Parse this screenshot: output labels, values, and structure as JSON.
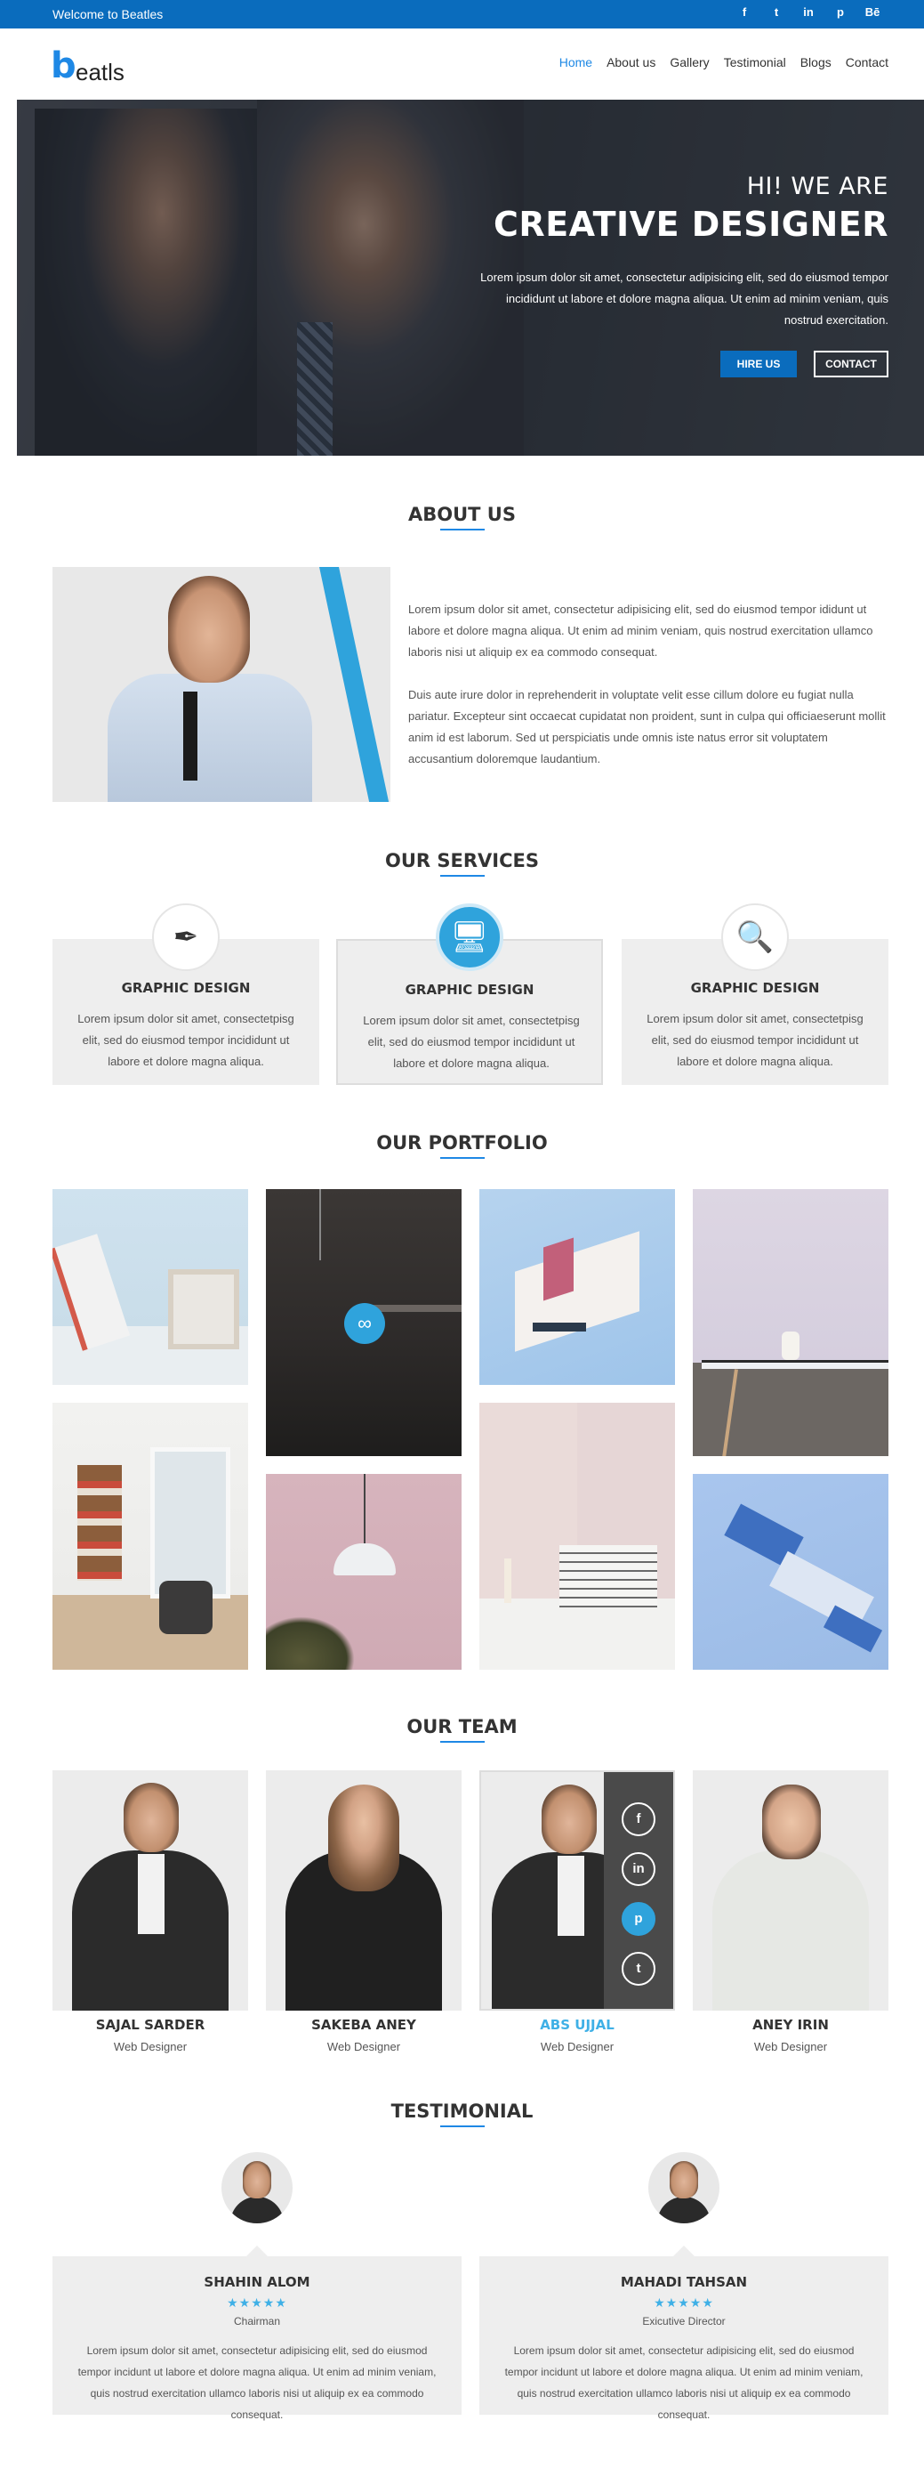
{
  "topbar": {
    "welcome": "Welcome to Beatles",
    "social": [
      {
        "icon": "facebook-icon",
        "glyph": "f"
      },
      {
        "icon": "twitter-icon",
        "glyph": "t"
      },
      {
        "icon": "linkedin-icon",
        "glyph": "in"
      },
      {
        "icon": "pinterest-icon",
        "glyph": "p"
      },
      {
        "icon": "behance-icon",
        "glyph": "Bē"
      }
    ]
  },
  "header": {
    "logo_b": "b",
    "logo_rest": "eatls",
    "nav": [
      "Home",
      "About us",
      "Gallery",
      "Testimonial",
      "Blogs",
      "Contact"
    ],
    "active": "Home"
  },
  "hero": {
    "line1": "HI! WE ARE",
    "line2": "CREATIVE DESIGNER",
    "desc": "Lorem ipsum dolor sit amet, consectetur adipisicing elit, sed do eiusmod tempor incididunt ut labore et dolore magna aliqua. Ut enim ad minim veniam, quis nostrud exercitation.",
    "hire": "HIRE US",
    "contact": "CONTACT"
  },
  "about": {
    "title": "ABOUT US",
    "p1": "Lorem ipsum dolor sit amet, consectetur adipisicing elit, sed do eiusmod tempor ididunt ut labore et dolore magna aliqua. Ut enim ad minim veniam, quis nostrud exercitation ullamco laboris nisi ut aliquip ex ea commodo consequat.",
    "p2": "Duis aute irure dolor in reprehenderit in voluptate velit esse cillum dolore eu fugiat nulla pariatur. Excepteur sint occaecat cupidatat non proident, sunt in culpa qui officiaeserunt mollit anim id est laborum. Sed ut perspiciatis unde omnis iste natus error sit voluptatem accusantium doloremque laudantium."
  },
  "services": {
    "title": "OUR SERVICES",
    "items": [
      {
        "title": "GRAPHIC DESIGN",
        "desc": "Lorem ipsum dolor sit amet, consectetpisg elit, sed do eiusmod tempor incididunt ut labore et dolore magna aliqua.",
        "icon": "pen-tool-icon",
        "glyph": "✒"
      },
      {
        "title": "GRAPHIC DESIGN",
        "desc": "Lorem ipsum dolor sit amet, consectetpisg elit, sed do eiusmod tempor incididunt ut labore et dolore magna aliqua.",
        "icon": "monitor-settings-icon",
        "glyph": "🖥"
      },
      {
        "title": "GRAPHIC DESIGN",
        "desc": "Lorem ipsum dolor sit amet, consectetpisg elit, sed do eiusmod tempor incididunt ut labore et dolore magna aliqua.",
        "icon": "magnifier-icon",
        "glyph": "🔍"
      }
    ]
  },
  "portfolio": {
    "title": "OUR PORTFOLIO",
    "link_icon": "link-icon"
  },
  "team": {
    "title": "OUR TEAM",
    "members": [
      {
        "name": "SAJAL SARDER",
        "role": "Web Designer"
      },
      {
        "name": "SAKEBA ANEY",
        "role": "Web Designer"
      },
      {
        "name": "ABS UJJAL",
        "role": "Web Designer"
      },
      {
        "name": "ANEY IRIN",
        "role": "Web Designer"
      }
    ],
    "hover_social": [
      "f",
      "in",
      "p",
      "t"
    ]
  },
  "testimonial": {
    "title": "TESTIMONIAL",
    "items": [
      {
        "name": "SHAHIN ALOM",
        "stars": "★★★★★",
        "role": "Chairman",
        "quote": "Lorem ipsum dolor sit amet, consectetur adipisicing elit, sed do eiusmod tempor incidunt ut labore et dolore magna aliqua. Ut enim ad minim veniam, quis nostrud exercitation ullamco laboris nisi ut aliquip ex ea commodo consequat."
      },
      {
        "name": "MAHADI TAHSAN",
        "stars": "★★★★★",
        "role": "Exicutive Director",
        "quote": "Lorem ipsum dolor sit amet, consectetur adipisicing elit, sed do eiusmod tempor incidunt ut labore et dolore magna aliqua. Ut enim ad minim veniam, quis nostrud exercitation ullamco laboris nisi ut aliquip ex ea commodo consequat."
      }
    ]
  },
  "colors": {
    "brand": "#0a6cbd",
    "accent": "#2fa3dc"
  }
}
